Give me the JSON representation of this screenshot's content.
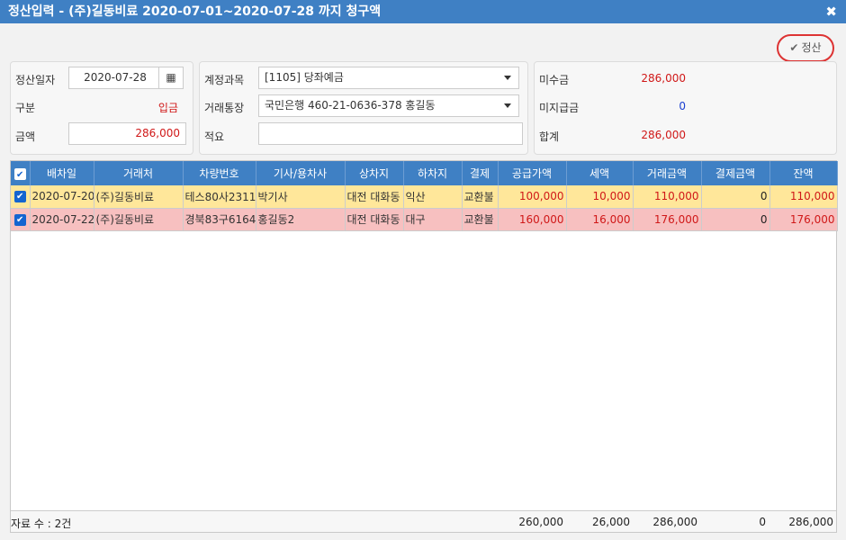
{
  "window": {
    "title": "정산입력 - (주)길동비료 2020-07-01~2020-07-28 까지 청구액"
  },
  "toolbar": {
    "settle_label": "정산"
  },
  "form": {
    "date_label": "정산일자",
    "date_value": "2020-07-28",
    "type_label": "구분",
    "type_value": "입금",
    "amount_label": "금액",
    "amount_value": "286,000",
    "account_label": "계정과목",
    "account_value": "[1105] 당좌예금",
    "bank_label": "거래통장",
    "bank_value": "국민은행 460-21-0636-378 홍길동",
    "memo_label": "적요",
    "memo_value": ""
  },
  "summary": {
    "unpaid_label": "미수금",
    "unpaid_value": "286,000",
    "nonpay_label": "미지급금",
    "nonpay_value": "0",
    "total_label": "합계",
    "total_value": "286,000"
  },
  "table": {
    "headers": [
      "배차일",
      "거래처",
      "차량번호",
      "기사/용차사",
      "상차지",
      "하차지",
      "결제",
      "공급가액",
      "세액",
      "거래금액",
      "결제금액",
      "잔액"
    ],
    "rows": [
      [
        "2020-07-20",
        "(주)길동비료",
        "테스80사2311",
        "박기사",
        "대전 대화동",
        "익산",
        "교환불",
        "100,000",
        "10,000",
        "110,000",
        "0",
        "110,000"
      ],
      [
        "2020-07-22",
        "(주)길동비료",
        "경북83구6164",
        "홍길동2",
        "대전 대화동",
        "대구",
        "교환불",
        "160,000",
        "16,000",
        "176,000",
        "0",
        "176,000"
      ]
    ]
  },
  "footer": {
    "count_label": "자료 수 : 2건",
    "supply_total": "260,000",
    "tax_total": "26,000",
    "trade_total": "286,000",
    "paid_total": "0",
    "balance_total": "286,000"
  },
  "icons": {
    "close": "close-icon",
    "calendar": "calendar-icon",
    "check": "check-icon"
  }
}
